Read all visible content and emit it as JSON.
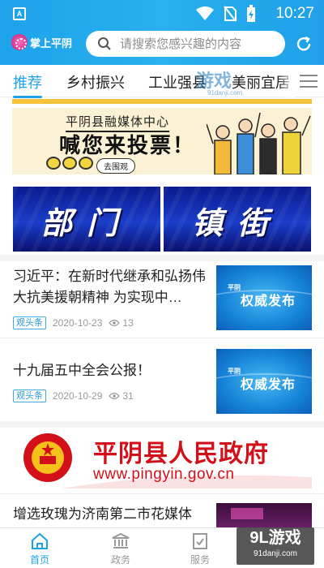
{
  "status_bar": {
    "app_badge": "A",
    "time": "10:27",
    "icons": [
      "wifi-icon",
      "no-sim-icon",
      "battery-charging-icon"
    ]
  },
  "header": {
    "logo_text": "掌上平阴",
    "search_placeholder": "请搜索您感兴趣的内容",
    "accent": "#1ea2ea"
  },
  "tabs": [
    {
      "label": "推荐",
      "active": true
    },
    {
      "label": "乡村振兴",
      "active": false
    },
    {
      "label": "工业强县",
      "active": false
    },
    {
      "label": "美丽宜居",
      "active": false
    }
  ],
  "overlay_watermark": {
    "main": "游戏",
    "sub": "91danji.com"
  },
  "vote_banner": {
    "line1": "平阴县融媒体中心",
    "line2": "喊您来投票！",
    "button": "去围观"
  },
  "dual_banners": [
    {
      "label": "部门"
    },
    {
      "label": "镇街"
    }
  ],
  "news": [
    {
      "title": "习近平：在新时代继承和弘扬伟大抗美援朝精神 为实现中…",
      "tag": "观头条",
      "date": "2020-10-23",
      "views": "13",
      "thumb_label": "权威发布",
      "thumb_logo": "平阴"
    },
    {
      "title": "十九届五中全会公报！",
      "tag": "观头条",
      "date": "2020-10-29",
      "views": "31",
      "thumb_label": "权威发布",
      "thumb_logo": "平阴"
    }
  ],
  "gov_banner": {
    "name": "平阴县人民政府",
    "url": "www.pingyin.gov.cn"
  },
  "news_partial": {
    "title": "增选玫瑰为济南第二市花媒体"
  },
  "bottom_nav": [
    {
      "label": "首页",
      "icon": "home-icon",
      "active": true
    },
    {
      "label": "政务",
      "icon": "government-icon",
      "active": false
    },
    {
      "label": "服务",
      "icon": "service-icon",
      "active": false
    }
  ],
  "corner_watermark": {
    "main": "9L游戏",
    "sub": "91danji.com"
  }
}
